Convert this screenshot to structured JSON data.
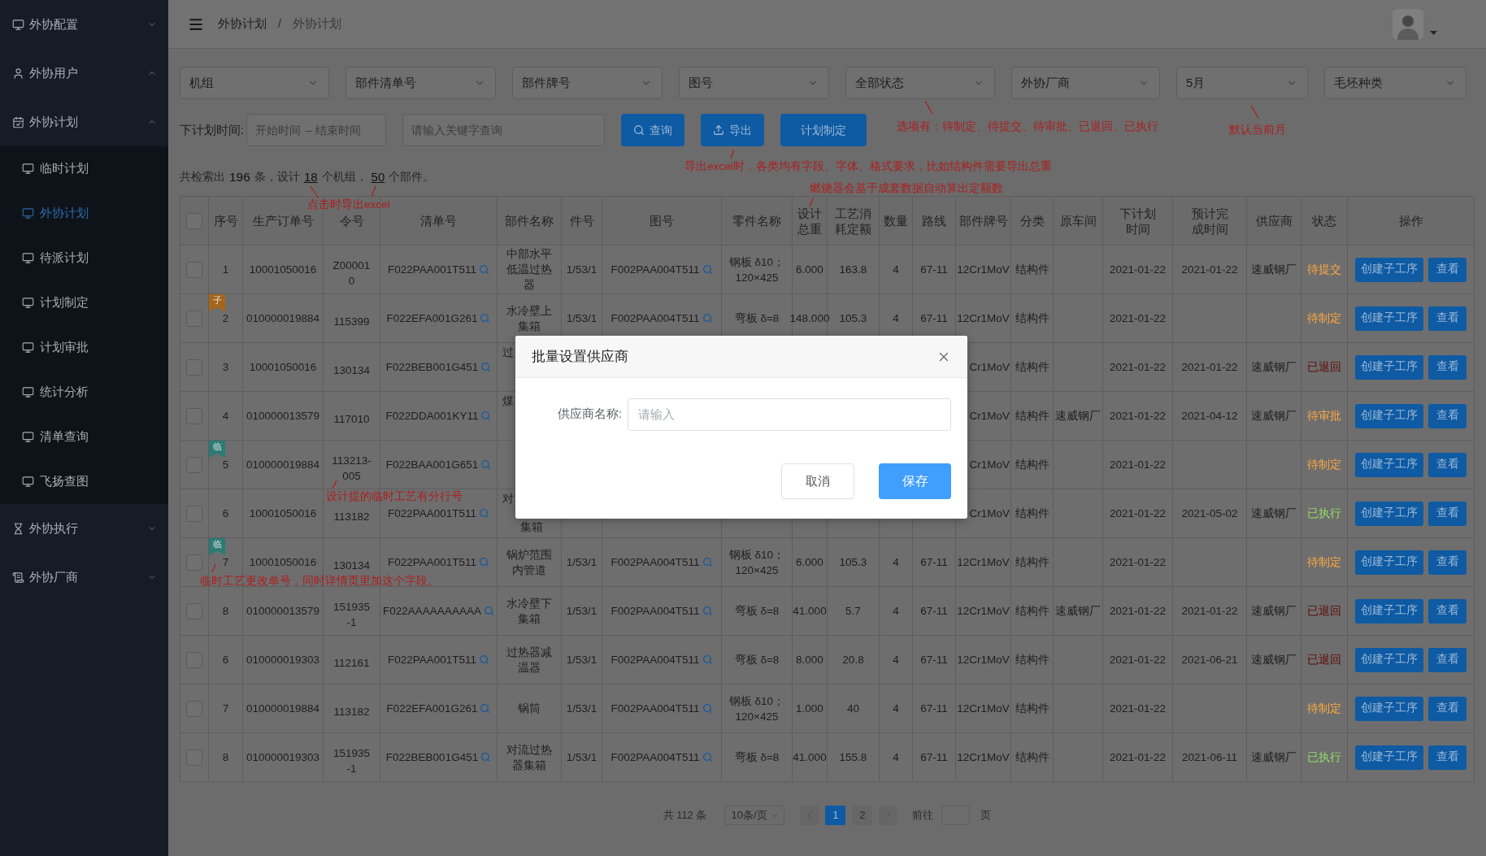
{
  "sidebar": {
    "items": [
      {
        "label": "外协配置",
        "expanded": false
      },
      {
        "label": "外协用户",
        "expanded": true
      },
      {
        "label": "外协计划",
        "expanded": true,
        "children": [
          {
            "label": "临时计划",
            "selected": false
          },
          {
            "label": "外协计划",
            "selected": true
          },
          {
            "label": "待派计划",
            "selected": false
          },
          {
            "label": "计划制定",
            "selected": false
          },
          {
            "label": "计划审批",
            "selected": false
          },
          {
            "label": "统计分析",
            "selected": false
          },
          {
            "label": "清单查询",
            "selected": false
          },
          {
            "label": "飞扬查图",
            "selected": false
          }
        ]
      },
      {
        "label": "外协执行",
        "expanded": false
      },
      {
        "label": "外协厂商",
        "expanded": false
      }
    ]
  },
  "header": {
    "breadcrumb": [
      "外协计划",
      "外协计划"
    ],
    "separator": "/"
  },
  "filters": {
    "selects": [
      "机组",
      "部件清单号",
      "部件牌号",
      "图号",
      "全部状态",
      "外协厂商",
      "5月",
      "毛坯种类"
    ],
    "date_label": "下计划时间:",
    "date_range": {
      "start_placeholder": "开始时间",
      "separator": "–",
      "end_placeholder": "结束时间"
    },
    "keyword": {
      "placeholder": "请输入关键字查询"
    },
    "buttons": [
      {
        "label": "查询",
        "kind": "search"
      },
      {
        "label": "导出",
        "kind": "export"
      },
      {
        "label": "计划制定",
        "kind": "plain"
      }
    ]
  },
  "summary": {
    "segments": [
      {
        "kind": "text",
        "text": "共检索出"
      },
      {
        "kind": "number",
        "text": "196"
      },
      {
        "kind": "text",
        "text": "条，设计"
      },
      {
        "kind": "link",
        "text": "18"
      },
      {
        "kind": "text",
        "text": "个机组，"
      },
      {
        "kind": "link",
        "text": "50"
      },
      {
        "kind": "text",
        "text": "个部件。"
      }
    ]
  },
  "table": {
    "all_checked": false,
    "columns": [
      "序号",
      "生产订单号",
      "令号",
      "清单号",
      "部件名称",
      "件号",
      "图号",
      "零件名称",
      "设计总重",
      "工艺消耗定额",
      "数量",
      "路线",
      "部件牌号",
      "分类",
      "原车间",
      "下计划时间",
      "预计完成时间",
      "供应商",
      "状态",
      "操作"
    ],
    "rows": [
      {
        "checked": false,
        "index": "1",
        "order_no": "10001050016",
        "command_no": "Z000010",
        "list_no": "F022PAA001T511",
        "part_name": "中部水平低温过热器",
        "item_no": "1/53/1",
        "drawing_no": "F002PAA004T511",
        "component_name": "钢板 δ10；120×425",
        "design_weight": "6.000",
        "quota": "163.8",
        "quantity": "4",
        "route": "67-11",
        "grade": "12Cr1MoV",
        "category": "结构件",
        "plan_date": "2021-01-22",
        "finish_date": "2021-01-22",
        "supplier": "速威钢厂",
        "status": {
          "text": "待提交",
          "color": "#ffa940"
        },
        "actions": [
          "创建子工序",
          "查看"
        ]
      },
      {
        "checked": false,
        "tag": {
          "text": "子",
          "color": "#a5661b"
        },
        "index": "2",
        "order_no": "010000019884",
        "command_no": "115399",
        "list_no": "F022EFA001G261",
        "part_name": "水冷壁上集箱",
        "item_no": "1/53/1",
        "drawing_no": "F002PAA004T511",
        "component_name": "弯板 δ=8",
        "design_weight": "148.000",
        "quota": "105.3",
        "quantity": "4",
        "route": "67-11",
        "grade": "12Cr1MoV",
        "category": "结构件",
        "plan_date": "2021-01-22",
        "status": {
          "text": "待制定",
          "color": "#ffa940"
        },
        "actions": [
          "创建子工序",
          "查看"
        ]
      },
      {
        "checked": false,
        "under_dialog": true,
        "index": "3",
        "order_no": "10001050016",
        "command_no": "130134",
        "list_no": "F022BEB001G451",
        "part_name_lines": [
          "过"
        ],
        "grade": "Cr1MoV",
        "category": "结构件",
        "plan_date": "2021-01-22",
        "finish_date": "2021-01-22",
        "supplier": "速威钢厂",
        "status": {
          "text": "已退回",
          "color": "#5e0606"
        },
        "actions": [
          "创建子工序",
          "查看"
        ]
      },
      {
        "checked": false,
        "under_dialog": true,
        "index": "4",
        "order_no": "010000013579",
        "command_no": "117010",
        "list_no": "F022DDA001KY11",
        "part_name_lines": [
          "煤"
        ],
        "grade": "Cr1MoV",
        "category": "结构件",
        "workshop": "速威钢厂",
        "plan_date": "2021-01-22",
        "finish_date": "2021-04-12",
        "supplier": "速威钢厂",
        "status": {
          "text": "待审批",
          "color": "#ffa940"
        },
        "actions": [
          "创建子工序",
          "查看"
        ]
      },
      {
        "checked": false,
        "under_dialog": true,
        "tag": {
          "text": "临",
          "color": "#2b7a75"
        },
        "index": "5",
        "order_no": "010000019884",
        "command_no": "113213-005",
        "list_no": "F022BAA001G651",
        "grade": "Cr1MoV",
        "category": "结构件",
        "plan_date": "2021-01-22",
        "status": {
          "text": "待制定",
          "color": "#ffa940"
        },
        "actions": [
          "创建子工序",
          "查看"
        ]
      },
      {
        "checked": false,
        "under_dialog": true,
        "index": "6",
        "order_no": "10001050016",
        "command_no": "113182",
        "list_no": "F022PAA001T511",
        "part_name_lines": [
          "对",
          "集箱"
        ],
        "grade": "Cr1MoV",
        "category": "结构件",
        "plan_date": "2021-01-22",
        "finish_date": "2021-05-02",
        "supplier": "速威钢厂",
        "status": {
          "text": "已执行",
          "color": "#95de64"
        },
        "actions": [
          "创建子工序",
          "查看"
        ]
      },
      {
        "checked": false,
        "tag": {
          "text": "临",
          "color": "#2b7a75"
        },
        "index": "7",
        "order_no": "10001050016",
        "command_no": "130134",
        "list_no": "F022PAA001T511",
        "part_name": "锅炉范围内管道",
        "item_no": "1/53/1",
        "drawing_no": "F002PAA004T511",
        "component_name": "钢板 δ10；120×425",
        "design_weight": "6.000",
        "quota": "105.3",
        "quantity": "4",
        "route": "67-11",
        "grade": "12Cr1MoV",
        "category": "结构件",
        "plan_date": "2021-01-22",
        "status": {
          "text": "待制定",
          "color": "#ffa940"
        },
        "actions": [
          "创建子工序",
          "查看"
        ]
      },
      {
        "checked": false,
        "index": "8",
        "order_no": "010000013579",
        "command_no": "151935-1",
        "list_no": "F022AAAAAAAAAA",
        "part_name": "水冷壁下集箱",
        "item_no": "1/53/1",
        "drawing_no": "F002PAA004T511",
        "component_name": "弯板 δ=8",
        "design_weight": "41.000",
        "quota": "5.7",
        "quantity": "4",
        "route": "67-11",
        "grade": "12Cr1MoV",
        "category": "结构件",
        "workshop": "速威钢厂",
        "plan_date": "2021-01-22",
        "finish_date": "2021-01-22",
        "supplier": "速威钢厂",
        "status": {
          "text": "已退回",
          "color": "#5e0606"
        },
        "actions": [
          "创建子工序",
          "查看"
        ]
      },
      {
        "checked": false,
        "index": "6",
        "order_no": "010000019303",
        "command_no": "112161",
        "list_no": "F022PAA001T511",
        "part_name": "过热器减温器",
        "item_no": "1/53/1",
        "drawing_no": "F002PAA004T511",
        "component_name": "弯板 δ=8",
        "design_weight": "8.000",
        "quota": "20.8",
        "quantity": "4",
        "route": "67-11",
        "grade": "12Cr1MoV",
        "category": "结构件",
        "plan_date": "2021-01-22",
        "finish_date": "2021-06-21",
        "supplier": "速威钢厂",
        "status": {
          "text": "已退回",
          "color": "#5e0606"
        },
        "actions": [
          "创建子工序",
          "查看"
        ]
      },
      {
        "checked": false,
        "index": "7",
        "order_no": "010000019884",
        "command_no": "113182",
        "list_no": "F022EFA001G261",
        "part_name": "锅筒",
        "item_no": "1/53/1",
        "drawing_no": "F002PAA004T511",
        "component_name": "钢板 δ10；120×425",
        "design_weight": "1.000",
        "quota": "40",
        "quantity": "4",
        "route": "67-11",
        "grade": "12Cr1MoV",
        "category": "结构件",
        "plan_date": "2021-01-22",
        "status": {
          "text": "待制定",
          "color": "#ffa940"
        },
        "actions": [
          "创建子工序",
          "查看"
        ]
      },
      {
        "checked": false,
        "index": "8",
        "order_no": "010000019303",
        "command_no": "151935-1",
        "list_no": "F022BEB001G451",
        "part_name": "对流过热器集箱",
        "item_no": "1/53/1",
        "drawing_no": "F002PAA004T511",
        "component_name": "弯板 δ=8",
        "design_weight": "41.000",
        "quota": "155.8",
        "quantity": "4",
        "route": "67-11",
        "grade": "12Cr1MoV",
        "category": "结构件",
        "plan_date": "2021-01-22",
        "finish_date": "2021-06-11",
        "supplier": "速威钢厂",
        "status": {
          "text": "已执行",
          "color": "#95de64"
        },
        "actions": [
          "创建子工序",
          "查看"
        ]
      }
    ]
  },
  "pagination": {
    "total": "共 112 条",
    "page_size": "10条/页",
    "pages": [
      {
        "label": "1",
        "selected": true
      },
      {
        "label": "2",
        "selected": false
      }
    ],
    "goto_label": "前往",
    "goto_suffix": "页"
  },
  "dialog": {
    "title": "批量设置供应商",
    "field_label": "供应商名称:",
    "placeholder": "请输入",
    "buttons": [
      {
        "label": "取消",
        "kind": "default"
      },
      {
        "label": "保存",
        "kind": "primary"
      }
    ]
  },
  "annotations": [
    {
      "text": "选项有：待制定、待提交、待审批、已退回、已执行"
    },
    {
      "text": "默认当前月"
    },
    {
      "text": "导出excel时，各类均有字段、字体、格式要求，比如结构件需要导出总重"
    },
    {
      "text": "燃烧器会基于成套数据自动算出定额数"
    },
    {
      "text": "点击时导出excel"
    },
    {
      "text": "设计提的临时工艺有分行号"
    },
    {
      "text": "临时工艺更改单号，同时详情页里加这个字段。"
    }
  ]
}
